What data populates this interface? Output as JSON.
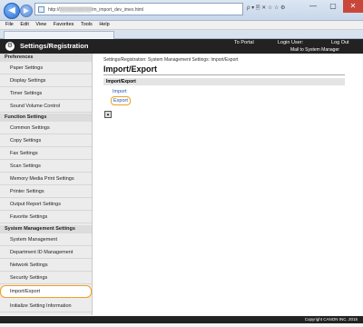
{
  "browser": {
    "address": "http://▒▒▒▒▒▒▒▒▒▒/m_import_dev_imex.html",
    "addr_tools": "ρ ▾ 🗎 ✕ ☆ ☆ ⚙",
    "menu": [
      "File",
      "Edit",
      "View",
      "Favorites",
      "Tools",
      "Help"
    ],
    "window_controls": [
      "—",
      "▢",
      "✕"
    ]
  },
  "header": {
    "title": "Settings/Registration",
    "to_portal": "To Portal",
    "login_user": "Login User:",
    "log_out": "Log Out",
    "mail": "Mail to System Manager"
  },
  "sidebar": {
    "preferences": {
      "title": "Preferences",
      "items": [
        "Paper Settings",
        "Display Settings",
        "Timer Settings",
        "Sound Volume Control"
      ]
    },
    "function": {
      "title": "Function Settings",
      "items": [
        "Common Settings",
        "Copy Settings",
        "Fax Settings",
        "Scan Settings",
        "Memory Media Print Settings",
        "Printer Settings",
        "Output Report Settings",
        "Favorite Settings"
      ]
    },
    "system": {
      "title": "System Management Settings",
      "items": [
        "System Management",
        "Department ID Management",
        "Network Settings",
        "Security Settings",
        "Import/Export",
        "Initialize Setting Information"
      ]
    }
  },
  "main": {
    "breadcrumb": "Settings/Registration: System Management Settings: Import/Export",
    "title": "Import/Export",
    "section": "Import/Export",
    "import_label": "Import",
    "export_label": "Export"
  },
  "footer": {
    "copyright": "Copyright CANON INC. 2015"
  }
}
